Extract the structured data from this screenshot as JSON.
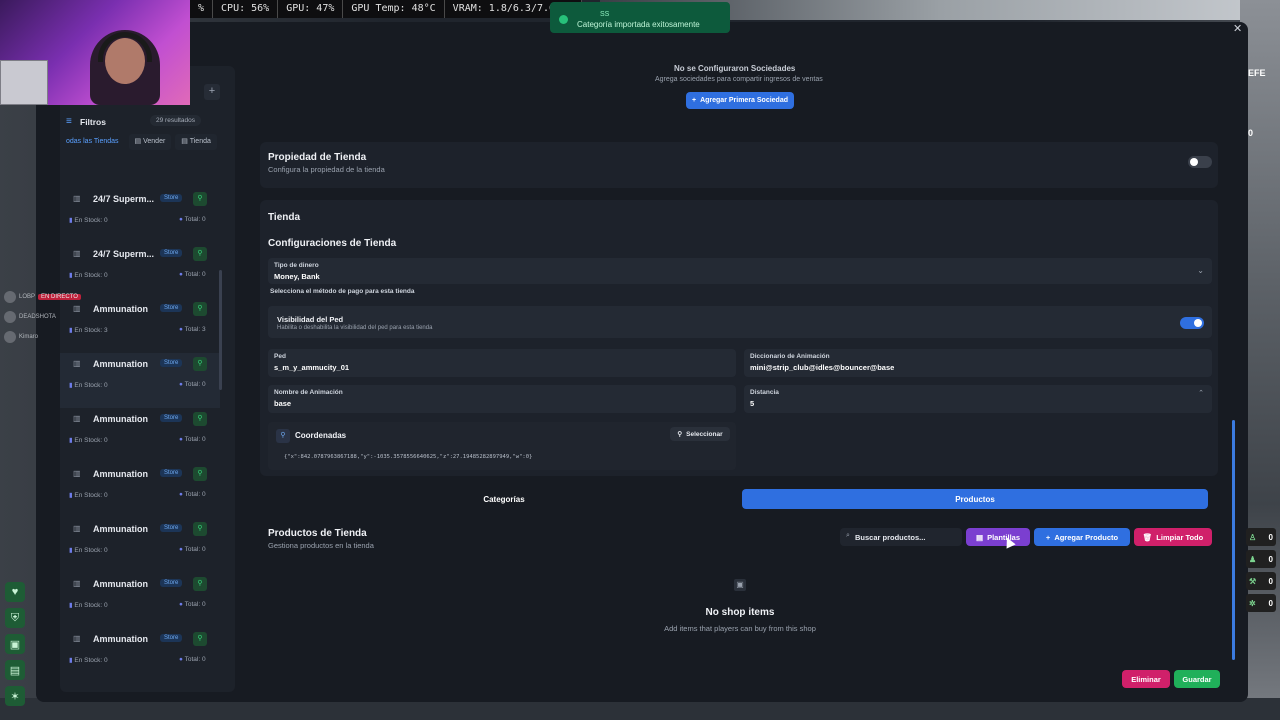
{
  "perf": {
    "pct": "%",
    "cpu": "CPU: 56%",
    "gpu": "GPU: 47%",
    "gpu_temp": "GPU Temp: 48°C",
    "vram": "VRAM: 1.8/6.3/7.6 GB"
  },
  "toast": {
    "title": "SS",
    "message": "Categoría importada exitosamente"
  },
  "chat": {
    "live_badge": "EN DIRECTO",
    "rp_tag": "LOBP",
    "users": [
      "DEADSHOTA",
      "Kimaro"
    ]
  },
  "sidebar": {
    "add_label": "+",
    "filters_label": "Filtros",
    "results_count": "29 resultados",
    "tabs": [
      "odas las Tiendas",
      "Vender",
      "Tienda"
    ],
    "items": [
      {
        "name": "24/7 Superm...",
        "tag": "Store",
        "stock": "En Stock: 0",
        "total": "Total: 0"
      },
      {
        "name": "24/7 Superm...",
        "tag": "Store",
        "stock": "En Stock: 0",
        "total": "Total: 0"
      },
      {
        "name": "Ammunation",
        "tag": "Store",
        "stock": "En Stock: 3",
        "total": "Total: 3"
      },
      {
        "name": "Ammunation",
        "tag": "Store",
        "stock": "En Stock: 0",
        "total": "Total: 0"
      },
      {
        "name": "Ammunation",
        "tag": "Store",
        "stock": "En Stock: 0",
        "total": "Total: 0"
      },
      {
        "name": "Ammunation",
        "tag": "Store",
        "stock": "En Stock: 0",
        "total": "Total: 0"
      },
      {
        "name": "Ammunation",
        "tag": "Store",
        "stock": "En Stock: 0",
        "total": "Total: 0"
      },
      {
        "name": "Ammunation",
        "tag": "Store",
        "stock": "En Stock: 0",
        "total": "Total: 0"
      },
      {
        "name": "Ammunation",
        "tag": "Store",
        "stock": "En Stock: 0",
        "total": "Total: 0"
      }
    ]
  },
  "societies": {
    "empty_title": "No se Configuraron Sociedades",
    "empty_sub": "Agrega sociedades para compartir ingresos de ventas",
    "add_button": "Agregar Primera Sociedad"
  },
  "property": {
    "title": "Propiedad de Tienda",
    "subtitle": "Configura la propiedad de la tienda",
    "enabled": false
  },
  "shop": {
    "section": "Tienda",
    "config_title": "Configuraciones de Tienda",
    "money_label": "Tipo de dinero",
    "money_value": "Money, Bank",
    "money_hint": "Selecciona el método de pago para esta tienda",
    "ped_vis_title": "Visibilidad del Ped",
    "ped_vis_sub": "Habilita o deshabilita la visibilidad del ped para esta tienda",
    "ped_vis_enabled": true,
    "ped_label": "Ped",
    "ped_value": "s_m_y_ammucity_01",
    "anim_dict_label": "Diccionario de Animación",
    "anim_dict_value": "mini@strip_club@idles@bouncer@base",
    "anim_name_label": "Nombre de Animación",
    "anim_name_value": "base",
    "distance_label": "Distancia",
    "distance_value": "5",
    "coords_label": "Coordenadas",
    "coords_button": "Seleccionar",
    "coords_value": "{\"x\":842.0787963867188,\"y\":-1035.3578556640625,\"z\":27.19485282897949,\"w\":0}"
  },
  "tabs": {
    "categories": "Categorías",
    "products": "Productos",
    "active": "products"
  },
  "products": {
    "title": "Productos de Tienda",
    "subtitle": "Gestiona productos en la tienda",
    "search_placeholder": "Buscar productos...",
    "templates_button": "Plantillas",
    "add_button": "Agregar Producto",
    "clear_button": "Limpiar Todo",
    "empty_title": "No shop items",
    "empty_sub": "Add items that players can buy from this shop"
  },
  "footer": {
    "delete_button": "Eliminar",
    "save_button": "Guardar"
  },
  "hud": {
    "top_label": "EFE",
    "top_value": "0",
    "values": [
      "0",
      "0",
      "0",
      "0"
    ]
  },
  "colors": {
    "accent_blue": "#2f6fe0",
    "purple": "#7b3fd0",
    "pink": "#d0206a",
    "green": "#20b05a"
  }
}
